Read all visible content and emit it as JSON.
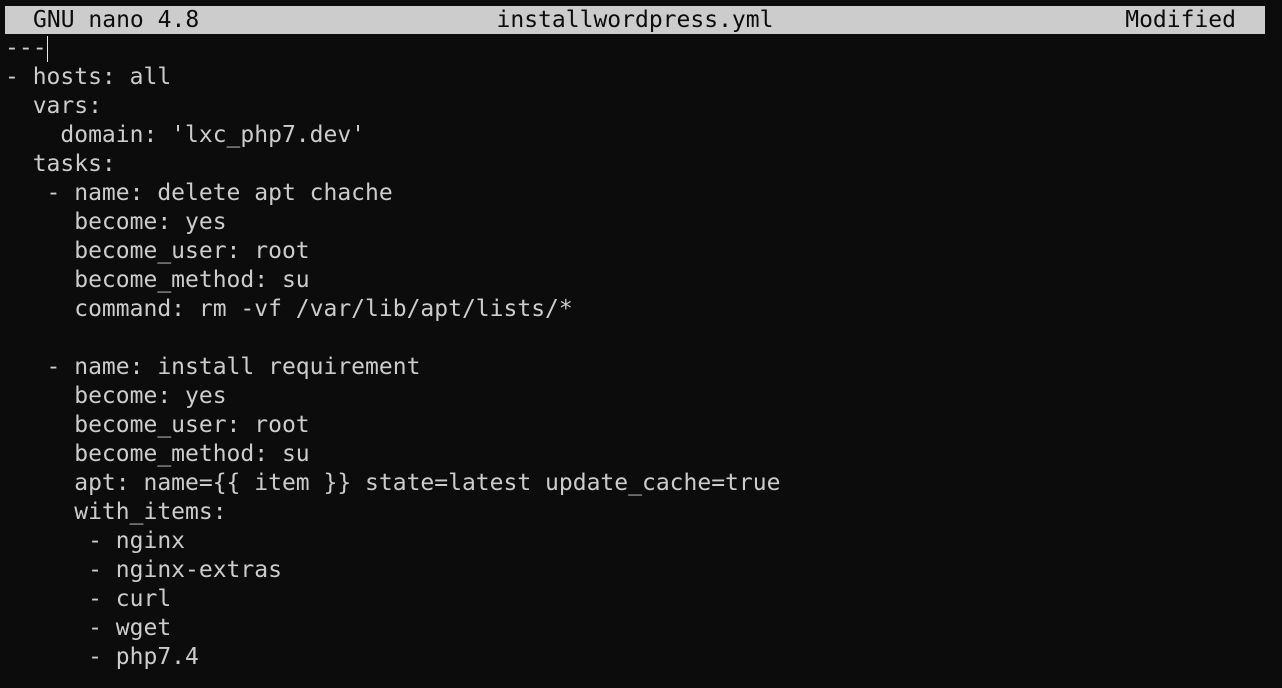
{
  "titlebar": {
    "app": "GNU nano 4.8",
    "filename": "installwordpress.yml",
    "status": "Modified"
  },
  "editor": {
    "lines": [
      "---",
      "- hosts: all",
      "  vars:",
      "    domain: 'lxc_php7.dev'",
      "  tasks:",
      "   - name: delete apt chache",
      "     become: yes",
      "     become_user: root",
      "     become_method: su",
      "     command: rm -vf /var/lib/apt/lists/*",
      "",
      "   - name: install requirement",
      "     become: yes",
      "     become_user: root",
      "     become_method: su",
      "     apt: name={{ item }} state=latest update_cache=true",
      "     with_items:",
      "      - nginx",
      "      - nginx-extras",
      "      - curl",
      "      - wget",
      "      - php7.4"
    ]
  }
}
